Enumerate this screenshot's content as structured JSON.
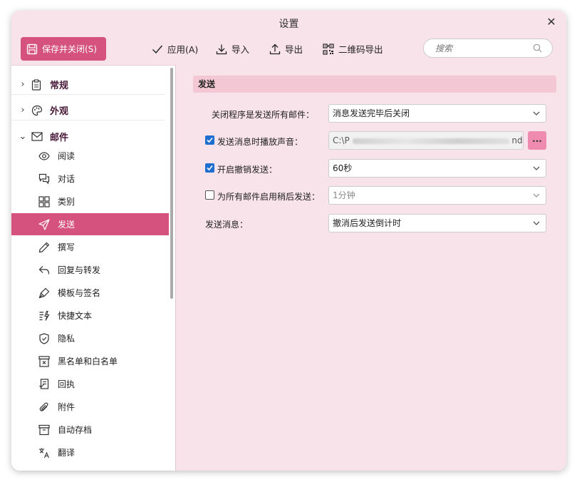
{
  "window": {
    "title": "设置"
  },
  "toolbar": {
    "save_close_label": "保存并关闭(S)",
    "apply_label": "应用(A)",
    "import_label": "导入",
    "export_label": "导出",
    "qr_export_label": "二维码导出",
    "search_placeholder": "搜索"
  },
  "sidebar": {
    "groups": [
      {
        "label": "常规",
        "expanded": false,
        "icon": "clipboard-icon"
      },
      {
        "label": "外观",
        "expanded": false,
        "icon": "palette-icon"
      },
      {
        "label": "邮件",
        "expanded": true,
        "icon": "envelope-icon"
      }
    ],
    "items": [
      {
        "label": "阅读",
        "icon": "eye-icon"
      },
      {
        "label": "对话",
        "icon": "chat-icon"
      },
      {
        "label": "类别",
        "icon": "grid-icon"
      },
      {
        "label": "发送",
        "icon": "paper-plane-icon",
        "selected": true
      },
      {
        "label": "撰写",
        "icon": "pencil-icon"
      },
      {
        "label": "回复与转发",
        "icon": "reply-icon"
      },
      {
        "label": "模板与签名",
        "icon": "pen-nib-icon"
      },
      {
        "label": "快捷文本",
        "icon": "quick-text-icon"
      },
      {
        "label": "隐私",
        "icon": "shield-icon"
      },
      {
        "label": "黑名单和白名单",
        "icon": "blocklist-icon"
      },
      {
        "label": "回执",
        "icon": "receipt-icon"
      },
      {
        "label": "附件",
        "icon": "paperclip-icon"
      },
      {
        "label": "自动存档",
        "icon": "archive-icon"
      },
      {
        "label": "翻译",
        "icon": "translate-icon"
      }
    ]
  },
  "content": {
    "section_title": "发送",
    "rows": [
      {
        "label": "关闭程序是发送所有邮件：",
        "value": "消息发送完毕后关闭"
      },
      {
        "label": "发送消息时播放声音：",
        "checked": true,
        "value": "C:\\P",
        "value_tail": "nd.",
        "browse_label": "..."
      },
      {
        "label": "开启撤销发送：",
        "checked": true,
        "value": "60秒"
      },
      {
        "label": "为所有邮件启用稍后发送：",
        "checked": false,
        "value": "1分钟"
      },
      {
        "label": "发送消息：",
        "value": "撤消后发送倒计时"
      }
    ]
  },
  "colors": {
    "accent": "#d5527e",
    "window_bg": "#f8e3ea",
    "section_bg": "#f4c7d5",
    "checkbox": "#1e6fd0"
  }
}
